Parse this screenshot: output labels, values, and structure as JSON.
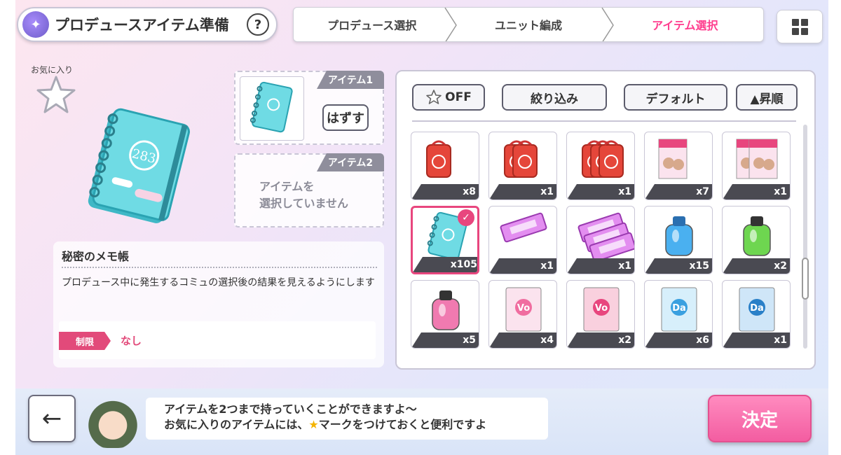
{
  "header": {
    "title": "プロデュースアイテム準備",
    "help_label": "?",
    "steps": [
      "プロデュース選択",
      "ユニット編成",
      "アイテム選択"
    ],
    "active_step": 2
  },
  "left": {
    "favorite_label": "お気に入り",
    "slot1": {
      "tag": "アイテム1",
      "remove_label": "はずす"
    },
    "slot2": {
      "tag": "アイテム2",
      "empty_text_line1": "アイテムを",
      "empty_text_line2": "選択していません"
    },
    "item_name": "秘密のメモ帳",
    "item_desc": "プロデュース中に発生するコミュの選択後の結果を見えるようにします",
    "limit_tag": "制限",
    "limit_value": "なし"
  },
  "panel": {
    "off_label": "OFF",
    "filter_label": "絞り込み",
    "sort_label": "デフォルト",
    "order_label": "▲昇順",
    "items": [
      {
        "kind": "omamori1",
        "count": "x8"
      },
      {
        "kind": "omamori2",
        "count": "x1"
      },
      {
        "kind": "omamori3",
        "count": "x1"
      },
      {
        "kind": "magazine1",
        "count": "x7"
      },
      {
        "kind": "magazine2",
        "count": "x1"
      },
      {
        "kind": "notebook",
        "count": "x105",
        "selected": true
      },
      {
        "kind": "ticket1",
        "count": "x1"
      },
      {
        "kind": "ticket3",
        "count": "x1"
      },
      {
        "kind": "perfume-blue",
        "count": "x15"
      },
      {
        "kind": "perfume-green",
        "count": "x2"
      },
      {
        "kind": "perfume-pink",
        "count": "x5"
      },
      {
        "kind": "vo-book1",
        "count": "x4"
      },
      {
        "kind": "vo-book2",
        "count": "x2"
      },
      {
        "kind": "da-book1",
        "count": "x6"
      },
      {
        "kind": "da-book2",
        "count": "x1"
      }
    ]
  },
  "footer": {
    "back_label": "←",
    "message_line1": "アイテムを2つまで持っていくことができますよ～",
    "message_line2a": "お気に入りのアイテムには、",
    "message_line2b": "マークをつけておくと便利ですよ",
    "confirm_label": "決定"
  },
  "colors": {
    "accent_pink": "#ff3d8e",
    "tag_gray": "#8f8e9c",
    "limit_red": "#e24a7a"
  }
}
